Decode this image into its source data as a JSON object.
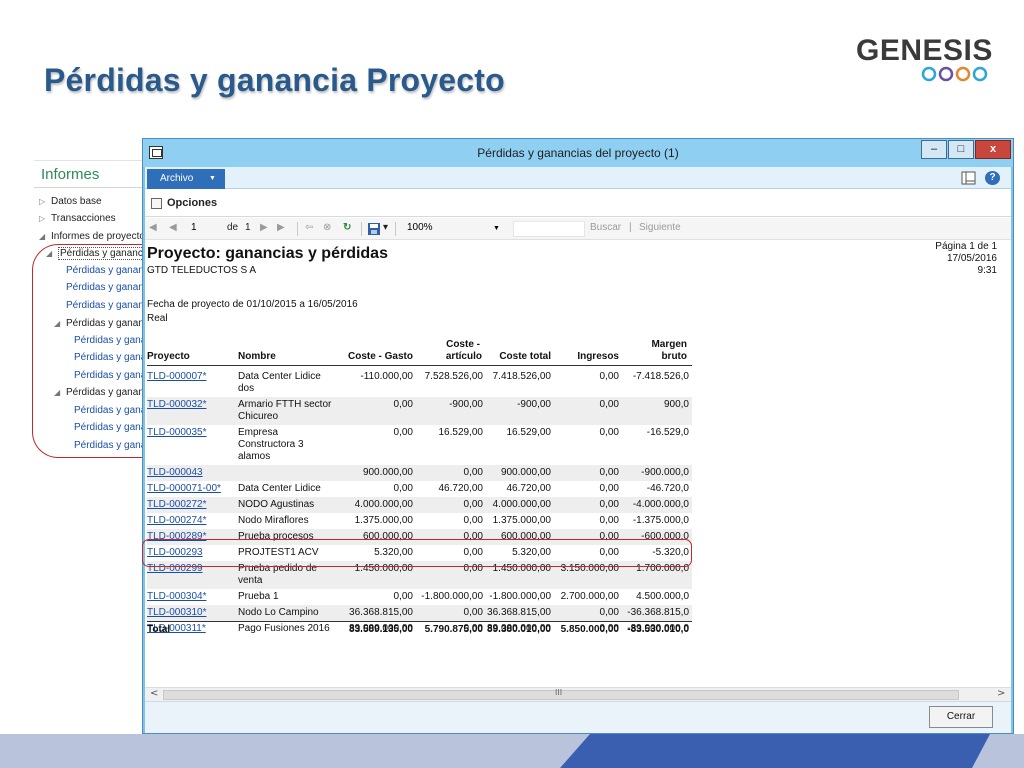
{
  "slide": {
    "title": "Pérdidas y ganancia Proyecto",
    "logo_text": "GENESIS",
    "colors": {
      "title": "#2a5a8c",
      "highlight": "#c0282d",
      "accent": "#3a5fb0",
      "ring": "#2aa7d8"
    }
  },
  "nav": {
    "header": "Informes",
    "items": [
      {
        "label": "Datos base",
        "arrow": "▷"
      },
      {
        "label": "Transacciones",
        "arrow": "▷"
      },
      {
        "label": "Informes de proyecto",
        "arrow": "◢"
      },
      {
        "label": "Pérdidas y ganancias",
        "arrow": "◢"
      },
      {
        "label": "Pérdidas y ganancias"
      },
      {
        "label": "Pérdidas y ganancias"
      },
      {
        "label": "Pérdidas y ganancias"
      },
      {
        "label": "Pérdidas y ganancias",
        "arrow": "◢"
      },
      {
        "label": "Pérdidas y ganancias"
      },
      {
        "label": "Pérdidas y ganancias"
      },
      {
        "label": "Pérdidas y ganancias"
      },
      {
        "label": "Pérdidas y ganancias",
        "arrow": "◢"
      },
      {
        "label": "Pérdidas y ganancias"
      },
      {
        "label": "Pérdidas y ganancias"
      },
      {
        "label": "Pérdidas y ganancias"
      }
    ]
  },
  "window": {
    "title": "Pérdidas y ganancias del proyecto (1)",
    "btn_min": "–",
    "btn_max": "□",
    "btn_close": "x",
    "archivo": "Archivo",
    "archivo_caret": "▼",
    "help_icon": "?",
    "opciones": "Opciones"
  },
  "toolbar": {
    "first": "◀",
    "prev": "◀",
    "page": "1",
    "of": "de",
    "total_pages": "1",
    "next": "▶",
    "last": "▶",
    "back": "⇦",
    "stop": "⊗",
    "refresh": "↻",
    "save": "▾",
    "zoom": "100%",
    "zoom_caret": "▼",
    "buscar": "Buscar",
    "sep": "|",
    "siguiente": "Siguiente"
  },
  "report": {
    "title": "Proyecto: ganancias y pérdidas",
    "company": "GTD TELEDUCTOS S A",
    "page_info": "Página 1 de 1",
    "date": "17/05/2016",
    "time": "9:31",
    "date_range": "Fecha de proyecto de 01/10/2015 a 16/05/2016",
    "mode": "Real",
    "columns": {
      "proyecto": "Proyecto",
      "nombre": "Nombre",
      "coste_gasto": "Coste - Gasto",
      "coste_articulo_1": "Coste -",
      "coste_articulo_2": "artículo",
      "coste_total": "Coste total",
      "ingresos": "Ingresos",
      "margen_1": "Margen",
      "margen_2": "bruto"
    },
    "rows": [
      {
        "id": "TLD-000007*",
        "name": [
          "Data Center Lidice",
          "dos"
        ],
        "gasto": "-110.000,00",
        "articulo": "7.528.526,00",
        "total": "7.418.526,00",
        "ingresos": "0,00",
        "margen": "-7.418.526,0"
      },
      {
        "id": "TLD-000032*",
        "name": [
          "Armario FTTH sector",
          "Chicureo"
        ],
        "gasto": "0,00",
        "articulo": "-900,00",
        "total": "-900,00",
        "ingresos": "0,00",
        "margen": "900,0"
      },
      {
        "id": "TLD-000035*",
        "name": [
          "Empresa",
          "Constructora 3",
          "alamos"
        ],
        "gasto": "0,00",
        "articulo": "16.529,00",
        "total": "16.529,00",
        "ingresos": "0,00",
        "margen": "-16.529,0"
      },
      {
        "id": "TLD-000043",
        "name": [
          ""
        ],
        "gasto": "900.000,00",
        "articulo": "0,00",
        "total": "900.000,00",
        "ingresos": "0,00",
        "margen": "-900.000,0"
      },
      {
        "id": "TLD-000071-00*",
        "name": [
          "Data Center Lidice"
        ],
        "gasto": "0,00",
        "articulo": "46.720,00",
        "total": "46.720,00",
        "ingresos": "0,00",
        "margen": "-46.720,0"
      },
      {
        "id": "TLD-000272*",
        "name": [
          "NODO Agustinas"
        ],
        "gasto": "4.000.000,00",
        "articulo": "0,00",
        "total": "4.000.000,00",
        "ingresos": "0,00",
        "margen": "-4.000.000,0"
      },
      {
        "id": "TLD-000274*",
        "name": [
          "Nodo Miraflores"
        ],
        "gasto": "1.375.000,00",
        "articulo": "0,00",
        "total": "1.375.000,00",
        "ingresos": "0,00",
        "margen": "-1.375.000,0"
      },
      {
        "id": "TLD-000289*",
        "name": [
          "Prueba procesos"
        ],
        "gasto": "600.000,00",
        "articulo": "0,00",
        "total": "600.000,00",
        "ingresos": "0,00",
        "margen": "-600.000,0"
      },
      {
        "id": "TLD-000293",
        "name": [
          "PROJTEST1 ACV"
        ],
        "gasto": "5.320,00",
        "articulo": "0,00",
        "total": "5.320,00",
        "ingresos": "0,00",
        "margen": "-5.320,0"
      },
      {
        "id": "TLD-000299",
        "name": [
          "Prueba pedido de",
          "venta"
        ],
        "gasto": "1.450.000,00",
        "articulo": "0,00",
        "total": "1.450.000,00",
        "ingresos": "3.150.000,00",
        "margen": "1.700.000,0"
      },
      {
        "id": "TLD-000304*",
        "name": [
          "Prueba 1"
        ],
        "gasto": "0,00",
        "articulo": "-1.800.000,00",
        "total": "-1.800.000,00",
        "ingresos": "2.700.000,00",
        "margen": "4.500.000,0"
      },
      {
        "id": "TLD-000310*",
        "name": [
          "Nodo Lo Campino"
        ],
        "gasto": "36.368.815,00",
        "articulo": "0,00",
        "total": "36.368.815,00",
        "ingresos": "0,00",
        "margen": "-36.368.815,0"
      },
      {
        "id": "TLD-000311*",
        "name": [
          "Pago Fusiones 2016"
        ],
        "gasto": "39.000.000,00",
        "articulo": "0,00",
        "total": "39.000.000,00",
        "ingresos": "0,00",
        "margen": "-39.000.000,0"
      }
    ],
    "total": {
      "label": "Total",
      "gasto": "83.589.135,00",
      "articulo": "5.790.875,00",
      "total": "89.380.010,00",
      "ingresos": "5.850.000,00",
      "margen": "-83.530.010,0"
    }
  },
  "scrollbar": {
    "left": "<",
    "right": ">",
    "grip": "III"
  },
  "footer": {
    "close": "Cerrar"
  }
}
